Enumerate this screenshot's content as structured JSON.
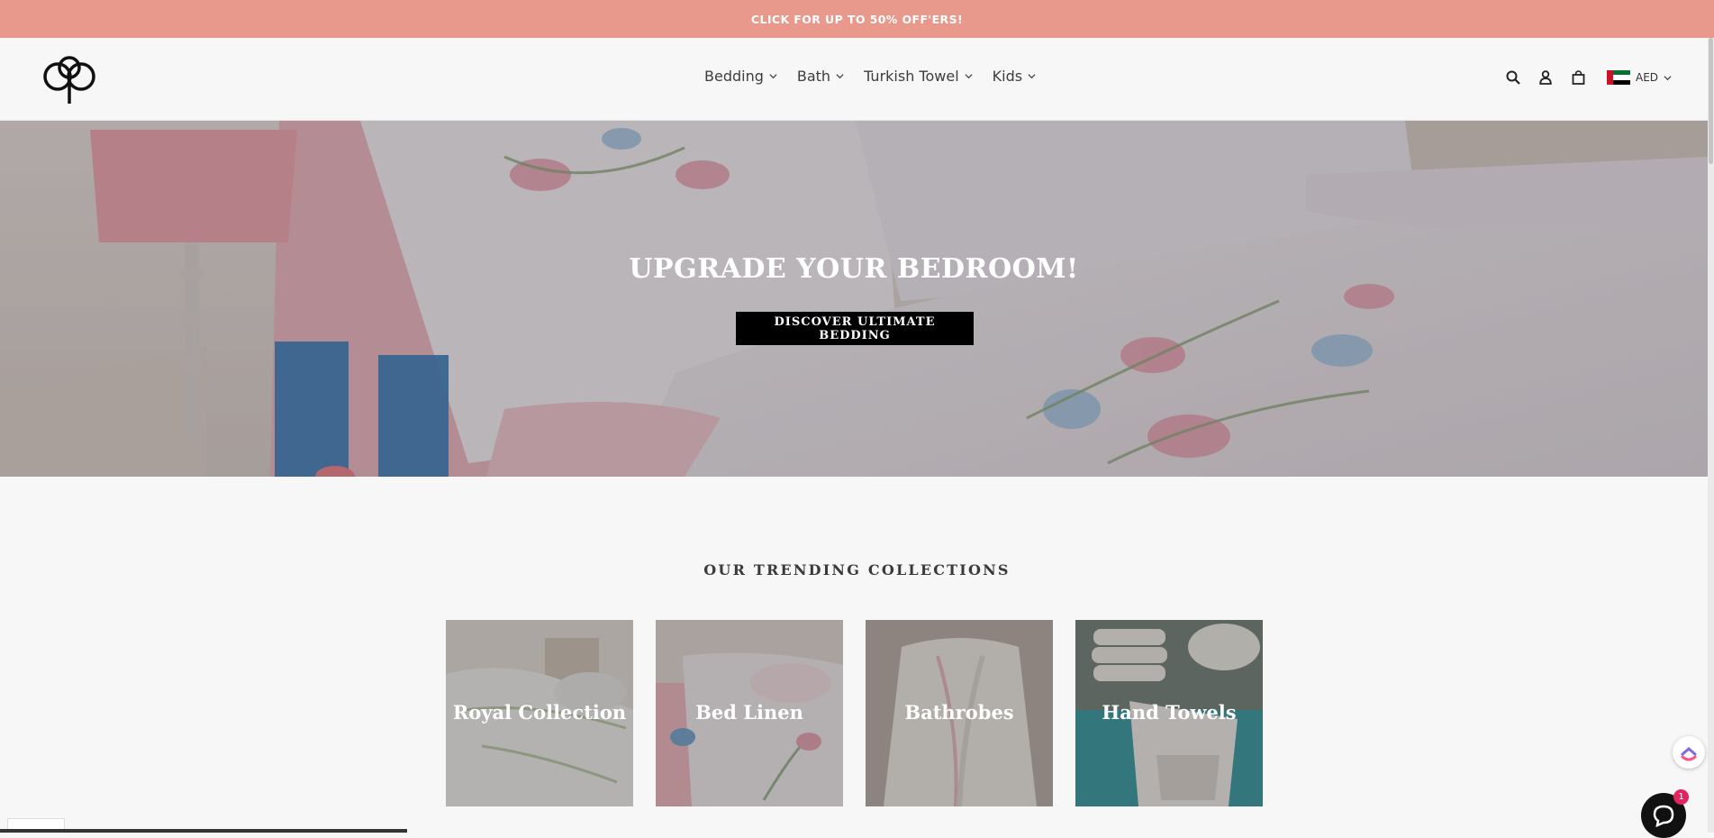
{
  "announcement": {
    "text": "CLICK FOR UP TO 50% OFF'ERS!"
  },
  "header": {
    "logo_icon": "tree-logo-icon",
    "nav": [
      {
        "label": "Bedding"
      },
      {
        "label": "Bath"
      },
      {
        "label": "Turkish Towel"
      },
      {
        "label": "Kids"
      }
    ],
    "icons": [
      "search-icon",
      "account-icon",
      "cart-icon"
    ],
    "currency": {
      "code": "AED",
      "flag": "uae-flag-icon"
    }
  },
  "hero": {
    "title": "UPGRADE YOUR BEDROOM!",
    "button_label": "DISCOVER ULTIMATE BEDDING"
  },
  "collections": {
    "title": "OUR TRENDING COLLECTIONS",
    "items": [
      {
        "label": "Royal Collection"
      },
      {
        "label": "Bed Linen"
      },
      {
        "label": "Bathrobes"
      },
      {
        "label": "Hand Towels"
      }
    ]
  },
  "chat": {
    "badge_count": "1"
  },
  "colors": {
    "announcement_bg": "#e8998b",
    "button_bg": "#000000",
    "page_bg": "#f7f7f7"
  }
}
